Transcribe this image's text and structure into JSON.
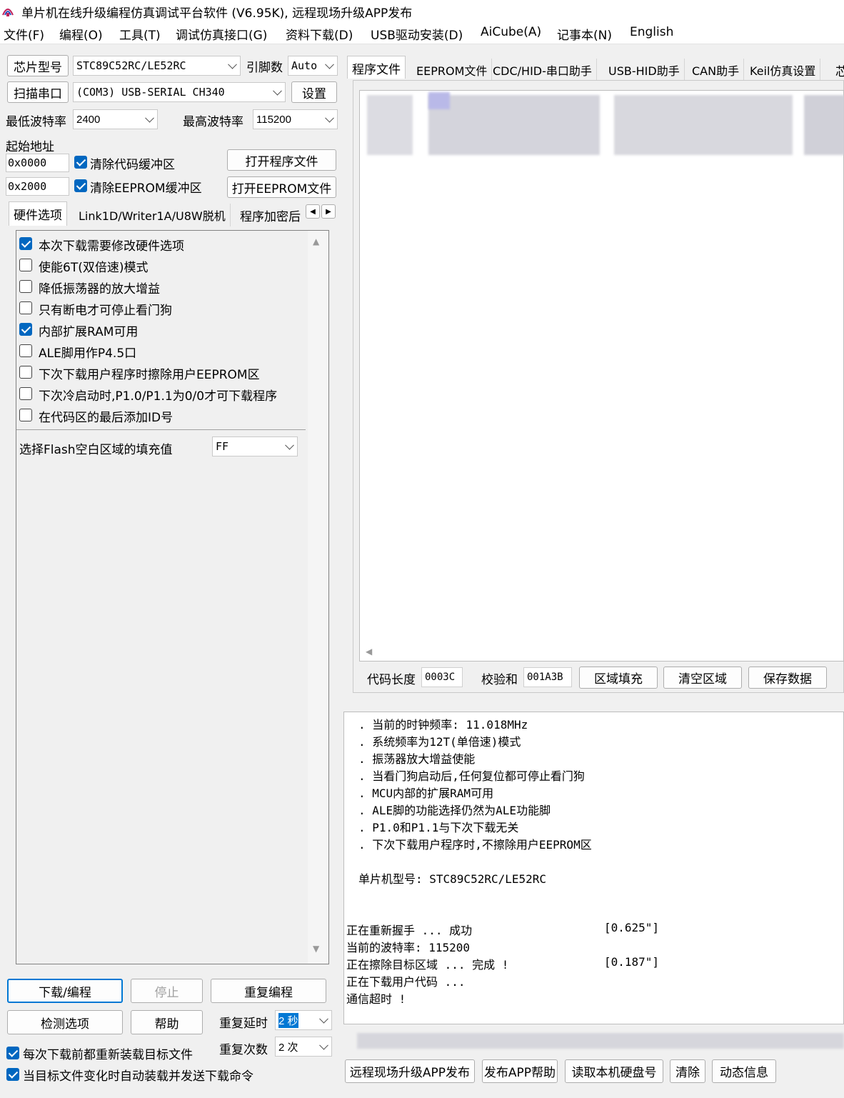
{
  "window": {
    "title": "单片机在线升级编程仿真调试平台软件 (V6.95K), 远程现场升级APP发布"
  },
  "menu": [
    "文件(F)",
    "编程(O)",
    "工具(T)",
    "调试仿真接口(G)",
    "资料下载(D)",
    "USB驱动安装(D)",
    "AiCube(A)",
    "记事本(N)",
    "English"
  ],
  "chip": {
    "label": "芯片型号",
    "value": "STC89C52RC/LE52RC",
    "pins_label": "引脚数",
    "pins_value": "Auto"
  },
  "port": {
    "scan_label": "扫描串口",
    "value": "(COM3) USB-SERIAL CH340",
    "settings_label": "设置"
  },
  "baud": {
    "min_label": "最低波特率",
    "min_value": "2400",
    "max_label": "最高波特率",
    "max_value": "115200"
  },
  "start_addr": {
    "label": "起始地址",
    "code_addr": "0x0000",
    "eeprom_addr": "0x2000",
    "clear_code_label": "清除代码缓冲区",
    "clear_eeprom_label": "清除EEPROM缓冲区",
    "open_prog_label": "打开程序文件",
    "open_eeprom_label": "打开EEPROM文件"
  },
  "left_tabs": [
    "硬件选项",
    "Link1D/Writer1A/U8W脱机",
    "程序加密后"
  ],
  "hw_options": [
    {
      "label": "本次下载需要修改硬件选项",
      "checked": true
    },
    {
      "label": "使能6T(双倍速)模式",
      "checked": false
    },
    {
      "label": "降低振荡器的放大增益",
      "checked": false
    },
    {
      "label": "只有断电才可停止看门狗",
      "checked": false
    },
    {
      "label": "内部扩展RAM可用",
      "checked": true
    },
    {
      "label": "ALE脚用作P4.5口",
      "checked": false
    },
    {
      "label": "下次下载用户程序时擦除用户EEPROM区",
      "checked": false
    },
    {
      "label": "下次冷启动时,P1.0/P1.1为0/0才可下载程序",
      "checked": false
    },
    {
      "label": "在代码区的最后添加ID号",
      "checked": false
    }
  ],
  "fill": {
    "label": "选择Flash空白区域的填充值",
    "value": "FF"
  },
  "actions": {
    "download": "下载/编程",
    "stop": "停止",
    "repeat_prog": "重复编程",
    "check": "检测选项",
    "help": "帮助",
    "repeat_delay_label": "重复延时",
    "repeat_delay_value": "2 秒",
    "repeat_count_label": "重复次数",
    "repeat_count_value": "2 次",
    "reload_label": "每次下载前都重新装载目标文件",
    "auto_load_label": "当目标文件变化时自动装载并发送下载命令"
  },
  "right_tabs": [
    "程序文件",
    "EEPROM文件",
    "CDC/HID-串口助手",
    "USB-HID助手",
    "CAN助手",
    "Keil仿真设置",
    "芯"
  ],
  "code_info": {
    "len_label": "代码长度",
    "len_value": "0003C",
    "sum_label": "校验和",
    "sum_value": "001A3B",
    "fill_btn": "区域填充",
    "clear_btn": "清空区域",
    "save_btn": "保存数据"
  },
  "log_lines": [
    ". 当前的时钟频率: 11.018MHz",
    ". 系统频率为12T(单倍速)模式",
    ". 振荡器放大增益使能",
    ". 当看门狗启动后,任何复位都可停止看门狗",
    ". MCU内部的扩展RAM可用",
    ". ALE脚的功能选择仍然为ALE功能脚",
    ". P1.0和P1.1与下次下载无关",
    ". 下次下载用户程序时,不擦除用户EEPROM区",
    "",
    "单片机型号: STC89C52RC/LE52RC"
  ],
  "log_status": [
    {
      "text": "正在重新握手 ... 成功",
      "time": "[0.625\"]"
    },
    {
      "text": "当前的波特率: 115200",
      "time": ""
    },
    {
      "text": "正在擦除目标区域 ... 完成 !",
      "time": "[0.187\"]"
    },
    {
      "text": "正在下载用户代码 ...",
      "time": ""
    },
    {
      "text": "通信超时 !",
      "time": ""
    }
  ],
  "bottom_buttons": [
    "远程现场升级APP发布",
    "发布APP帮助",
    "读取本机硬盘号",
    "清除",
    "动态信息"
  ]
}
